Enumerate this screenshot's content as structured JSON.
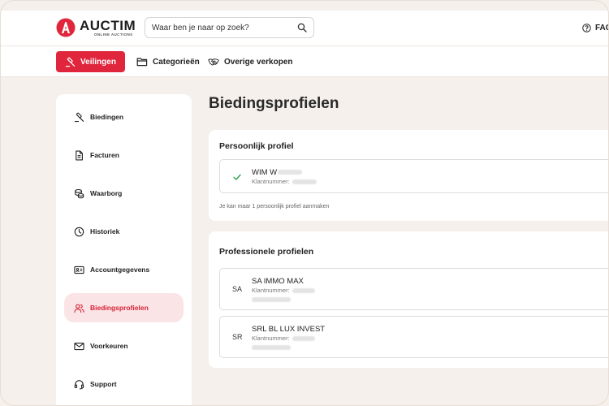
{
  "brand": {
    "name": "AUCTIM",
    "tagline": "ONLINE AUCTIONS"
  },
  "search": {
    "placeholder": "Waar ben je naar op zoek?"
  },
  "header": {
    "faq_label": "FAQ"
  },
  "nav": {
    "primary_label": "Veilingen",
    "links": [
      "Categorieën",
      "Overige verkopen"
    ]
  },
  "sidebar": {
    "items": [
      {
        "label": "Biedingen",
        "icon": "gavel-icon"
      },
      {
        "label": "Facturen",
        "icon": "invoice-icon"
      },
      {
        "label": "Waarborg",
        "icon": "coins-icon"
      },
      {
        "label": "Historiek",
        "icon": "clock-icon"
      },
      {
        "label": "Accountgegevens",
        "icon": "id-card-icon"
      },
      {
        "label": "Biedingsprofielen",
        "icon": "users-icon",
        "active": true
      },
      {
        "label": "Voorkeuren",
        "icon": "mail-icon"
      },
      {
        "label": "Support",
        "icon": "headset-icon"
      }
    ]
  },
  "main": {
    "title": "Biedingsprofielen",
    "personal": {
      "heading": "Persoonlijk profiel",
      "profile": {
        "name": "WIM W",
        "client_label": "Klantnummer:"
      },
      "note": "Je kan maar 1 persoonlijk profiel aanmaken"
    },
    "professional": {
      "heading": "Professionele profielen",
      "profiles": [
        {
          "initials": "SA",
          "name": "SA IMMO MAX",
          "client_label": "Klantnummer:"
        },
        {
          "initials": "SR",
          "name": "SRL BL LUX INVEST",
          "client_label": "Klantnummer:"
        }
      ]
    }
  },
  "colors": {
    "accent": "#e0263c",
    "active_bg": "#fbe4e6",
    "page_bg": "#f5f0eb",
    "check": "#2e9e48"
  }
}
